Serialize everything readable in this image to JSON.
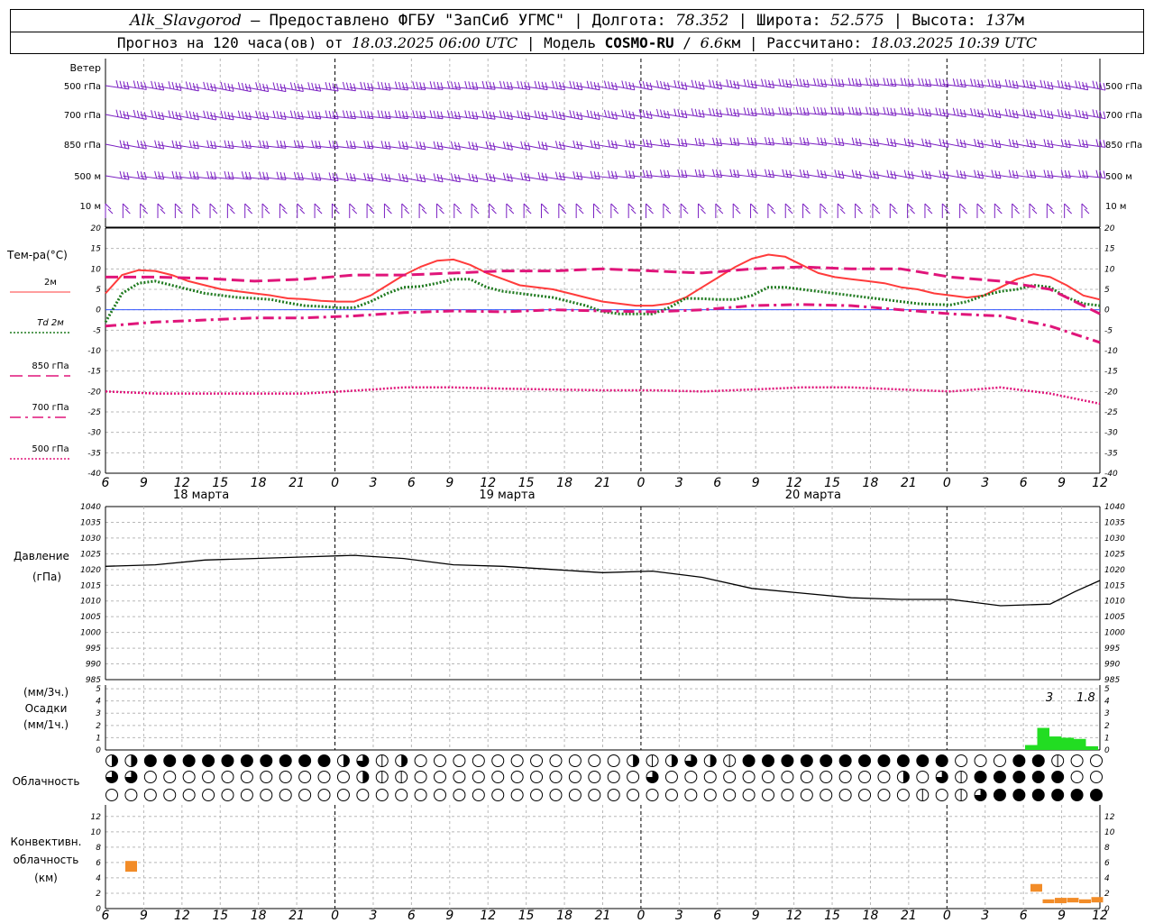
{
  "header": {
    "station": "Alk_Slavgorod",
    "dash": " — ",
    "provider": "Предоставлено ФГБУ \"ЗапСиб УГМС\"",
    "lon_label": "Долгота:",
    "lon": "78.352",
    "lat_label": "Широта:",
    "lat": "52.575",
    "alt_label": "Высота:",
    "alt": "137",
    "alt_unit": "м",
    "sep": " | ",
    "forecast_label": "Прогноз на 120 часа(ов) от",
    "forecast_start": "18.03.2025 06:00 UTC",
    "model_label": "Модель",
    "model": "COSMO-RU",
    "slash": " / ",
    "resolution": "6.6",
    "res_unit": "км",
    "calc_label": "Рассчитано:",
    "calc_time": "18.03.2025 10:39 UTC"
  },
  "x_axis": {
    "tick_hours": [
      "6",
      "9",
      "12",
      "15",
      "18",
      "21",
      "0",
      "3",
      "6",
      "9",
      "12",
      "15",
      "18",
      "21",
      "0",
      "3",
      "6",
      "9",
      "12",
      "15",
      "18",
      "21",
      "0",
      "3",
      "6",
      "9",
      "12"
    ],
    "day_labels": [
      {
        "text": "18 марта",
        "index": 2.5
      },
      {
        "text": "19 марта",
        "index": 10.5
      },
      {
        "text": "20 марта",
        "index": 18.5
      }
    ],
    "midnight_indices": [
      6,
      14,
      22
    ]
  },
  "panels": {
    "wind": {
      "title": "Ветер",
      "levels": [
        "500 гПа",
        "700 гПа",
        "850 гПа",
        "500 м",
        "10 м"
      ],
      "color": "#7a1fc2"
    },
    "temperature": {
      "title": "Тем-ра(°C)",
      "legend": [
        {
          "label": "2м",
          "color": "#ff3b3b",
          "style": "solid"
        },
        {
          "label": "Td  2м",
          "color": "#1f7a1f",
          "style": "dotted"
        },
        {
          "label": "850 гПа",
          "color": "#e0157a",
          "style": "dashed"
        },
        {
          "label": "700 гПа",
          "color": "#e0157a",
          "style": "dashdot"
        },
        {
          "label": "500 гПа",
          "color": "#e0157a",
          "style": "dots"
        }
      ],
      "ticks": [
        "20",
        "15",
        "10",
        "5",
        "0",
        "-5",
        "-10",
        "-15",
        "-20",
        "-25",
        "-30",
        "-35",
        "-40"
      ]
    },
    "pressure": {
      "title": "Давление",
      "unit": "(гПа)",
      "ticks": [
        "1040",
        "1035",
        "1030",
        "1025",
        "1020",
        "1015",
        "1010",
        "1005",
        "1000",
        "995",
        "990",
        "985"
      ]
    },
    "precip": {
      "unit3": "(мм/3ч.)",
      "title": "Осадки",
      "unit1": "(мм/1ч.)",
      "ticks": [
        "5",
        "4",
        "3",
        "2",
        "1",
        "0"
      ],
      "labels": [
        {
          "text": "3",
          "hour": 78
        },
        {
          "text": "1.8",
          "hour": 81
        }
      ]
    },
    "cloud": {
      "title": "Облачность"
    },
    "convective": {
      "title1": "Конвективн.",
      "title2": "облачность",
      "unit": "(км)",
      "ticks": [
        "12",
        "10",
        "8",
        "6",
        "4",
        "2",
        "0"
      ]
    }
  },
  "chart_data": [
    {
      "type": "line",
      "title": "Тем-ра(°C)",
      "ylim": [
        -40,
        20
      ],
      "x_unit": "hours from 18.03.2025 06:00 UTC",
      "series": [
        {
          "name": "2м",
          "x": [
            0,
            2,
            4,
            6,
            8,
            10,
            12,
            14,
            16,
            18,
            20,
            22,
            24,
            26,
            28,
            30,
            32,
            34,
            36,
            38,
            40,
            42,
            44,
            46,
            48,
            50,
            52,
            54,
            56,
            58,
            60,
            62,
            64,
            66,
            68,
            70,
            72,
            74,
            76,
            78,
            80,
            82,
            84,
            86,
            88,
            90,
            92,
            94,
            96,
            98,
            100,
            102,
            104,
            106,
            108,
            110,
            112,
            114,
            116,
            118,
            120
          ],
          "values": [
            4,
            8.5,
            9.7,
            9.5,
            8.5,
            7,
            6,
            5,
            4.5,
            4,
            3.5,
            2.8,
            2.6,
            2.2,
            2,
            2,
            3.5,
            6,
            8.5,
            10.5,
            12,
            12.3,
            11,
            9,
            7.5,
            6,
            5.5,
            5,
            4,
            3,
            2,
            1.5,
            1,
            1,
            1.5,
            3,
            5.5,
            8,
            10.5,
            12.5,
            13.5,
            13,
            11,
            9,
            8,
            7.5,
            7,
            6.5,
            5.5,
            5,
            4,
            3.5,
            3,
            3.5,
            5.5,
            7.5,
            8.7,
            8,
            6,
            3.5,
            2.5
          ]
        },
        {
          "name": "Td  2м",
          "x": [
            0,
            2,
            4,
            6,
            8,
            10,
            12,
            14,
            16,
            18,
            20,
            22,
            24,
            26,
            28,
            30,
            32,
            34,
            36,
            38,
            40,
            42,
            44,
            46,
            48,
            50,
            52,
            54,
            56,
            58,
            60,
            62,
            64,
            66,
            68,
            70,
            72,
            74,
            76,
            78,
            80,
            82,
            84,
            86,
            88,
            90,
            92,
            94,
            96,
            98,
            100,
            102,
            104,
            106,
            108,
            110,
            112,
            114,
            116,
            118,
            120
          ],
          "values": [
            -3,
            4,
            6.5,
            7,
            6,
            5,
            4,
            3.5,
            3,
            2.8,
            2.5,
            1.7,
            1,
            0.8,
            0.5,
            0.5,
            2,
            4,
            5.5,
            5.7,
            6.5,
            7.5,
            7.5,
            5.5,
            4.5,
            4,
            3.5,
            3,
            2,
            1,
            -0.5,
            -1,
            -1,
            -1,
            0.5,
            2.8,
            2.7,
            2.5,
            2.5,
            3.5,
            5.5,
            5.5,
            5,
            4.5,
            4,
            3.5,
            3,
            2.5,
            2,
            1.5,
            1.3,
            1.2,
            2,
            3.5,
            4.5,
            5,
            6,
            5.5,
            3,
            1.5,
            1
          ]
        },
        {
          "name": "850 гПа",
          "x": [
            0,
            6,
            12,
            18,
            24,
            30,
            36,
            42,
            48,
            54,
            60,
            66,
            72,
            78,
            84,
            90,
            96,
            102,
            108,
            114,
            120
          ],
          "values": [
            8,
            8,
            7.7,
            7,
            7.5,
            8.5,
            8.5,
            9,
            9.5,
            9.5,
            10,
            9.5,
            9,
            10,
            10.5,
            10,
            10,
            8,
            7,
            5,
            -1
          ]
        },
        {
          "name": "700 гПа",
          "x": [
            0,
            6,
            12,
            18,
            24,
            30,
            36,
            42,
            48,
            54,
            60,
            66,
            72,
            78,
            84,
            90,
            96,
            102,
            108,
            114,
            120
          ],
          "values": [
            -4,
            -3,
            -2.5,
            -2,
            -2,
            -1.5,
            -0.7,
            -0.3,
            -0.5,
            0,
            -0.3,
            -0.5,
            0,
            1,
            1.3,
            1,
            0,
            -1,
            -1.5,
            -4,
            -8
          ]
        },
        {
          "name": "500 гПа",
          "x": [
            0,
            6,
            12,
            18,
            24,
            30,
            36,
            42,
            48,
            54,
            60,
            66,
            72,
            78,
            84,
            90,
            96,
            102,
            108,
            114,
            120
          ],
          "values": [
            -20,
            -20.5,
            -20.5,
            -20.5,
            -20.5,
            -19.8,
            -19,
            -19,
            -19.3,
            -19.5,
            -19.7,
            -19.7,
            -20,
            -19.5,
            -19,
            -19,
            -19.5,
            -20,
            -19,
            -20.5,
            -23
          ]
        }
      ]
    },
    {
      "type": "line",
      "title": "Давление",
      "ylabel": "(гПа)",
      "ylim": [
        985,
        1040
      ],
      "x": [
        0,
        6,
        12,
        18,
        24,
        30,
        36,
        42,
        48,
        54,
        60,
        66,
        72,
        78,
        84,
        90,
        96,
        102,
        108,
        114,
        117,
        120
      ],
      "values": [
        1021,
        1021.5,
        1023,
        1023.5,
        1024,
        1024.5,
        1023.5,
        1021.5,
        1021,
        1020,
        1019,
        1019.5,
        1017.5,
        1014,
        1012.5,
        1011,
        1010.5,
        1010.5,
        1008.5,
        1009,
        1013,
        1016.5
      ]
    },
    {
      "type": "bar",
      "title": "Осадки",
      "ylabel": "(мм/1ч.)",
      "ylim": [
        0,
        5
      ],
      "x": [
        77,
        78,
        79,
        80,
        81,
        82,
        83
      ],
      "values": [
        0.4,
        1.8,
        1.1,
        1.0,
        0.9,
        0.3,
        0
      ]
    },
    {
      "type": "bar",
      "title": "Конвективн. облачность",
      "ylabel": "(км)",
      "ylim": [
        0,
        13
      ],
      "ranges": [
        {
          "x": 3,
          "bottom": 4.8,
          "top": 6.2
        },
        {
          "x": 78,
          "bottom": 2.2,
          "top": 3.2
        },
        {
          "x": 80,
          "bottom": 0.7,
          "top": 1.2
        },
        {
          "x": 82,
          "bottom": 0.7,
          "top": 1.4
        },
        {
          "x": 84,
          "bottom": 0.8,
          "top": 1.4
        },
        {
          "x": 86,
          "bottom": 0.7,
          "top": 1.2
        },
        {
          "x": 88,
          "bottom": 0.8,
          "top": 1.5
        }
      ]
    }
  ]
}
